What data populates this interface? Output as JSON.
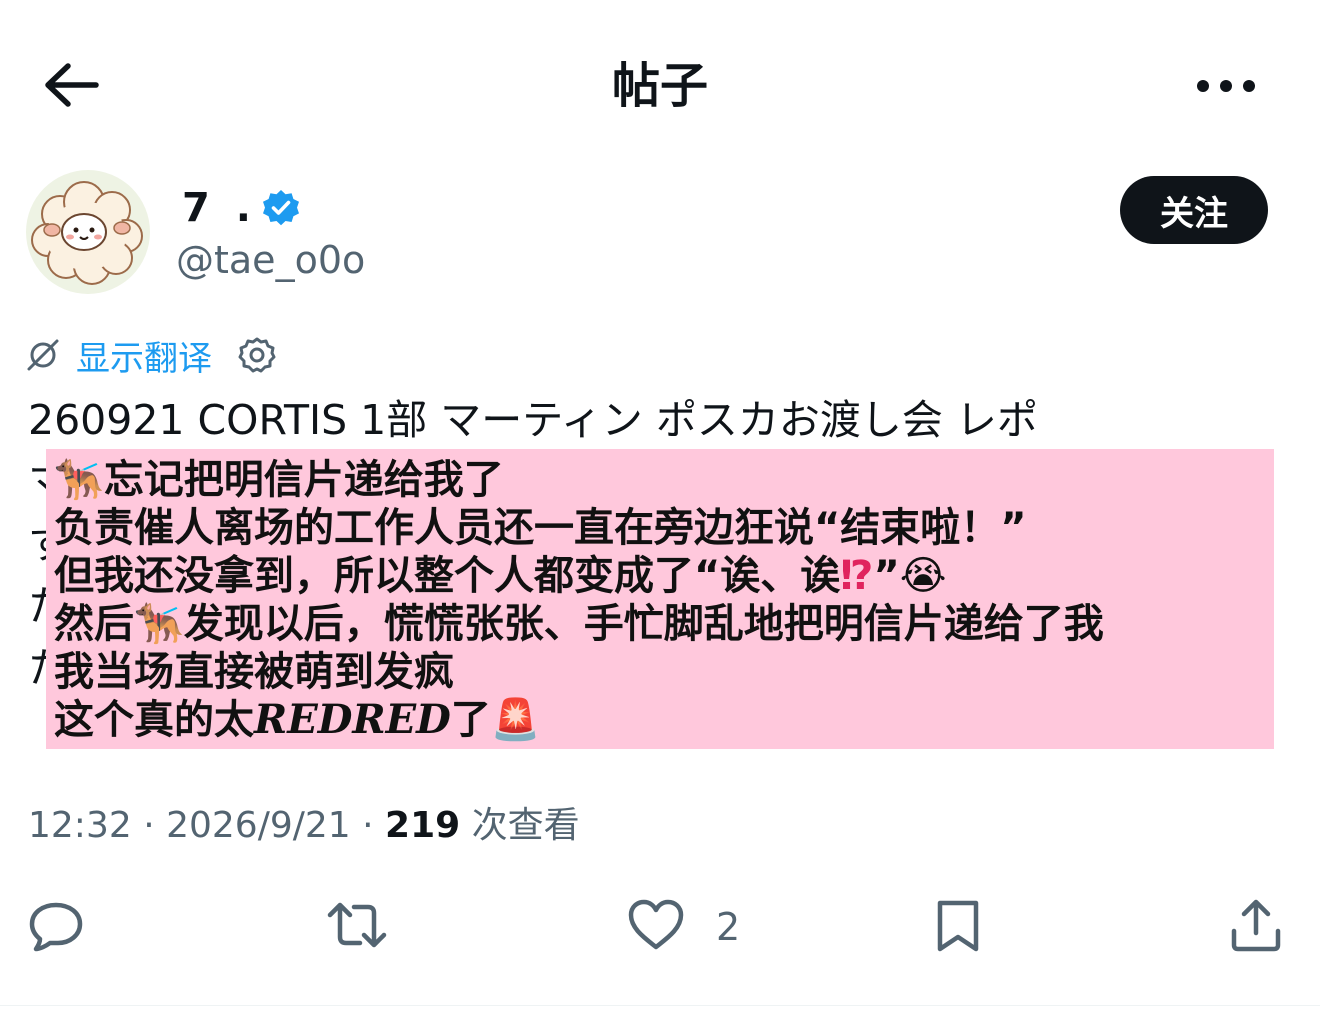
{
  "header": {
    "title": "帖子",
    "back_icon": "arrow-left-icon",
    "more_icon": "more-horizontal-icon"
  },
  "author": {
    "name": "7 .",
    "handle": "@tae_o0o",
    "verified_icon": "verified-badge-icon",
    "verified_color": "#1d9bf0",
    "follow_label": "关注"
  },
  "translate": {
    "label": "显示翻译",
    "icon": "translate-icon",
    "settings_icon": "gear-icon",
    "link_color": "#1d9bf0"
  },
  "post": {
    "first_line": "260921 CORTIS 1部 マーティン ポスカお渡し会 レポ",
    "hidden_line_starts": [
      "マ",
      "す",
      "た",
      "た"
    ],
    "overlay_color": "#ffc8dc",
    "overlay_lines": [
      {
        "pre": "🐕‍🦺",
        "text": "忘记把明信片递给我了"
      },
      {
        "text": "负责催人离场的工作人员还一直在旁边狂说“结束啦！”"
      },
      {
        "text": "但我还没拿到，所以整个人都变成了“诶、诶",
        "mark": "⁉",
        "post": "”😭"
      },
      {
        "text": "然后",
        "mid": "🐕‍🦺",
        "post": "发现以后，慌慌张张、手忙脚乱地把明信片递给了我"
      },
      {
        "text": "我当场直接被萌到发疯"
      },
      {
        "text": "这个真的太",
        "styled": "REDRED",
        "post": "了🚨"
      }
    ]
  },
  "meta": {
    "time": "12:32",
    "sep": " · ",
    "date": "2026/9/21",
    "views_count": "219",
    "views_label": " 次查看"
  },
  "actions": {
    "reply_icon": "reply-icon",
    "retweet_icon": "retweet-icon",
    "like_icon": "heart-icon",
    "like_count": "2",
    "bookmark_icon": "bookmark-icon",
    "share_icon": "share-icon"
  }
}
